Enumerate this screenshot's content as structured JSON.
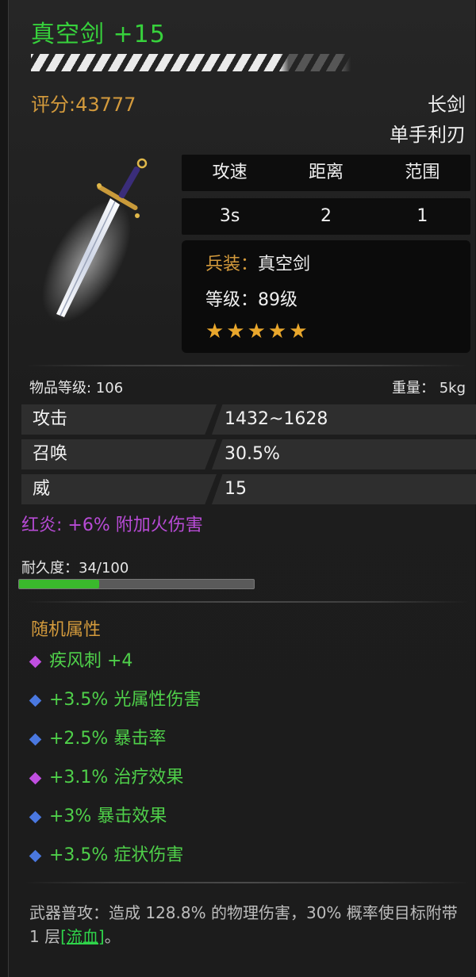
{
  "item": {
    "name": "真空剑 +15",
    "score": "评分:43777",
    "type_main": "长剑",
    "type_sub": "单手利刃"
  },
  "stats_header": [
    "攻速",
    "距离",
    "范围"
  ],
  "stats_values": [
    "3s",
    "2",
    "1"
  ],
  "info": {
    "bing_label": "兵装：",
    "bing_value": "真空剑",
    "level_label": "等级：",
    "level_value": "89级",
    "stars": "★★★★★",
    "star_count": 5
  },
  "meta": {
    "item_level": "物品等级: 106",
    "weight": "重量： 5kg"
  },
  "attributes": [
    {
      "name": "攻击",
      "value": "1432~1628"
    },
    {
      "name": "召唤",
      "value": "30.5%"
    },
    {
      "name": "威",
      "value": "15"
    }
  ],
  "fire_bonus": "红炎: +6% 附加火伤害",
  "durability": {
    "label": "耐久度：34/100",
    "current": 34,
    "max": 100
  },
  "random_attrs": {
    "title": "随机属性",
    "items": [
      {
        "text": "疾风刺 +4",
        "gem": "purple"
      },
      {
        "text": "+3.5% 光属性伤害",
        "gem": "blue"
      },
      {
        "text": "+2.5% 暴击率",
        "gem": "blue"
      },
      {
        "text": "+3.1% 治疗效果",
        "gem": "purple"
      },
      {
        "text": "+3% 暴击效果",
        "gem": "blue"
      },
      {
        "text": "+3.5% 症状伤害",
        "gem": "blue"
      }
    ]
  },
  "description": {
    "part1": "武器普攻：造成 128.8% 的物理伤害，30% 概率使目标附带 1 层",
    "link": "[流血]",
    "part2": "。"
  },
  "colors": {
    "name_green": "#37d23c",
    "gold": "#d39a3c",
    "purple": "#b84bd6",
    "attr_green": "#4fd04a",
    "gem_purple": "#c04fe0",
    "gem_blue": "#4a78e0"
  }
}
